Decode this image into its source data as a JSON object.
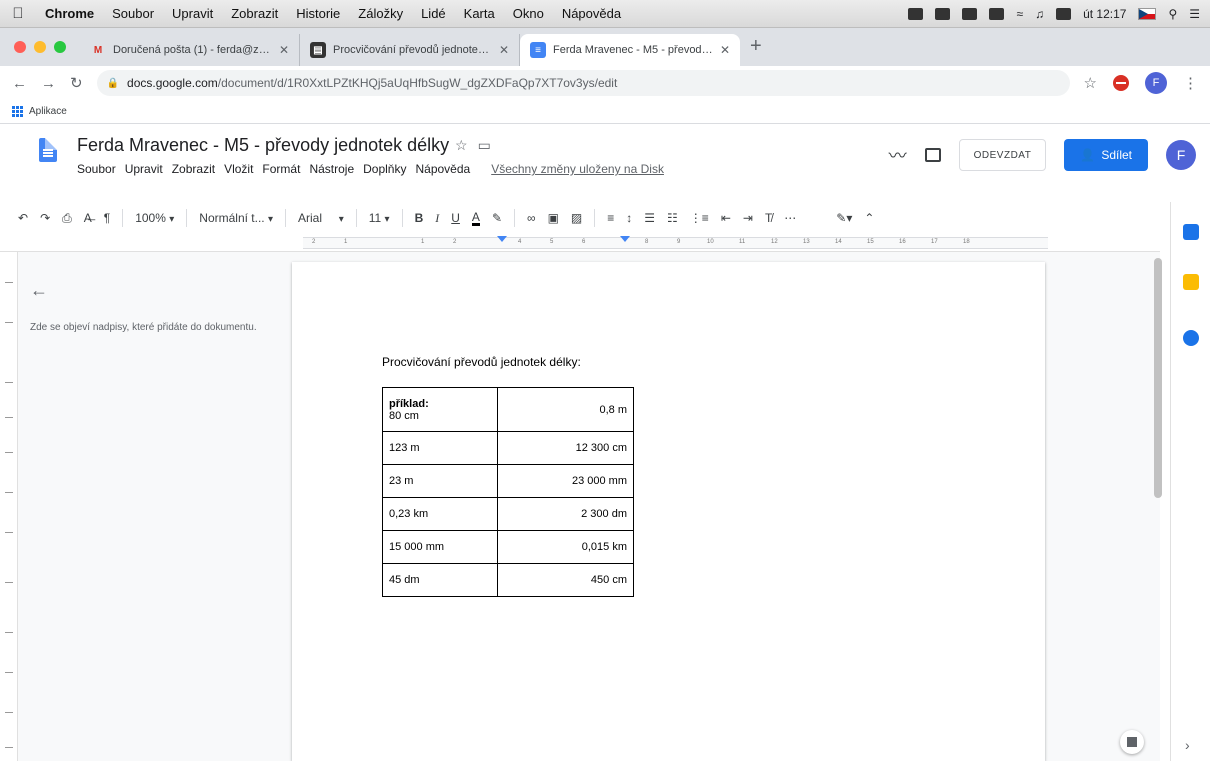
{
  "menubar": {
    "items": [
      "Chrome",
      "Soubor",
      "Upravit",
      "Zobrazit",
      "Historie",
      "Záložky",
      "Lidé",
      "Karta",
      "Okno",
      "Nápověda"
    ],
    "clock": "út 12:17"
  },
  "tabs": [
    {
      "title": "Doručená pošta (1) - ferda@zs..."
    },
    {
      "title": "Procvičování převodů jednotek..."
    },
    {
      "title": "Ferda Mravenec - M5 - převody..."
    }
  ],
  "address": {
    "host": "docs.google.com",
    "path": "/document/d/1R0XxtLPZtKHQj5aUqHfbSugW_dgZXDFaQp7XT7ov3ys/edit"
  },
  "bookmarks": {
    "apps_label": "Aplikace"
  },
  "doc": {
    "title": "Ferda Mravenec - M5 - převody jednotek délky",
    "menu": [
      "Soubor",
      "Upravit",
      "Zobrazit",
      "Vložit",
      "Formát",
      "Nástroje",
      "Doplňky",
      "Nápověda"
    ],
    "saved_status": "Všechny změny uloženy na Disk",
    "turn_in_label": "ODEVZDAT",
    "share_label": "Sdílet",
    "avatar_letter": "F"
  },
  "toolbar": {
    "zoom": "100%",
    "style": "Normální t...",
    "font": "Arial",
    "size": "11"
  },
  "outline": {
    "hint": "Zde se objeví nadpisy, které přidáte do dokumentu."
  },
  "content": {
    "heading": "Procvičování převodů jednotek délky:",
    "example_label": "příklad:",
    "rows": [
      {
        "left": "80 cm",
        "right": "0,8 m"
      },
      {
        "left": "123 m",
        "right": "12 300 cm"
      },
      {
        "left": "23 m",
        "right": "23 000 mm"
      },
      {
        "left": "0,23 km",
        "right": "2 300 dm"
      },
      {
        "left": "15 000 mm",
        "right": "0,015 km"
      },
      {
        "left": "45 dm",
        "right": "450 cm"
      }
    ]
  },
  "colors": {
    "accent": "#1a73e8",
    "doc_blue": "#4285f4"
  }
}
